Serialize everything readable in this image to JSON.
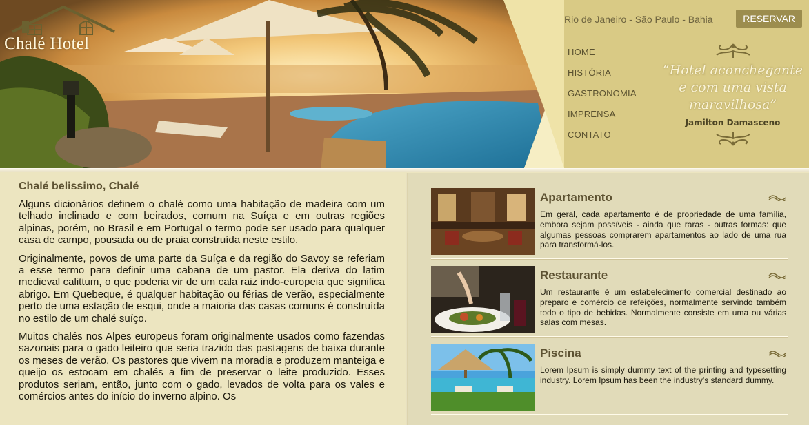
{
  "brand": {
    "name": "Chalé Hotel"
  },
  "header": {
    "location": "Rio de Janeiro - São Paulo - Bahia",
    "reserve_label": "RESERVAR",
    "nav": [
      {
        "label": "HOME"
      },
      {
        "label": "HISTÓRIA"
      },
      {
        "label": "GASTRONOMIA"
      },
      {
        "label": "IMPRENSA"
      },
      {
        "label": "CONTATO"
      }
    ],
    "quote": "“Hotel aconchegante e com uma vista maravilhosa”",
    "quote_author": "Jamilton Damasceno"
  },
  "article": {
    "title": "Chalé belissimo, Chalé",
    "paragraphs": [
      "Alguns dicionários definem o chalé como uma habitação de madeira com um telhado inclinado e com beirados, comum na Suíça e em outras regiões alpinas, porém, no Brasil e em Portugal o termo pode ser usado para qualquer casa de campo, pousada ou de praia construída neste estilo.",
      "Originalmente, povos de uma parte da Suíça e da região do Savoy se referiam a esse termo para definir uma cabana de um pastor. Ela deriva do latim medieval calittum, o que poderia vir de um cala raiz indo-europeia que significa abrigo. Em Quebeque, é qualquer habitação ou férias de verão, especialmente perto de uma estação de esqui, onde a maioria das casas comuns é construída no estilo de um chalé suíço.",
      "Muitos chalés nos Alpes europeus foram originalmente usados como fazendas sazonais para o gado leiteiro que seria trazido das pastagens de baixa durante os meses de verão. Os pastores que vivem na moradia e produzem manteiga e queijo os estocam em chalés a fim de preservar o leite produzido. Esses produtos seriam, então, junto com o gado, levados de volta para os vales e comércios antes do início do inverno alpino. Os"
    ]
  },
  "cards": [
    {
      "title": "Apartamento",
      "text": "Em geral, cada apartamento é de propriedade de uma família, embora sejam possíveis - ainda que raras - outras formas: que algumas pessoas comprarem apartamentos ao lado de uma rua para transformá-los."
    },
    {
      "title": "Restaurante",
      "text": "Um restaurante é um estabelecimento comercial destinado ao preparo e comércio de refeições, normalmente servindo também todo o tipo de bebidas. Normalmente consiste em uma ou várias salas com mesas."
    },
    {
      "title": "Piscina",
      "text": "Lorem Ipsum is simply dummy text of the printing and typesetting industry. Lorem Ipsum has been the industry's standard dummy."
    }
  ],
  "colors": {
    "header_bg": "#d9ca85",
    "accent": "#9c8d4e",
    "heading": "#5d5232",
    "page_bg": "#ece5c0"
  }
}
